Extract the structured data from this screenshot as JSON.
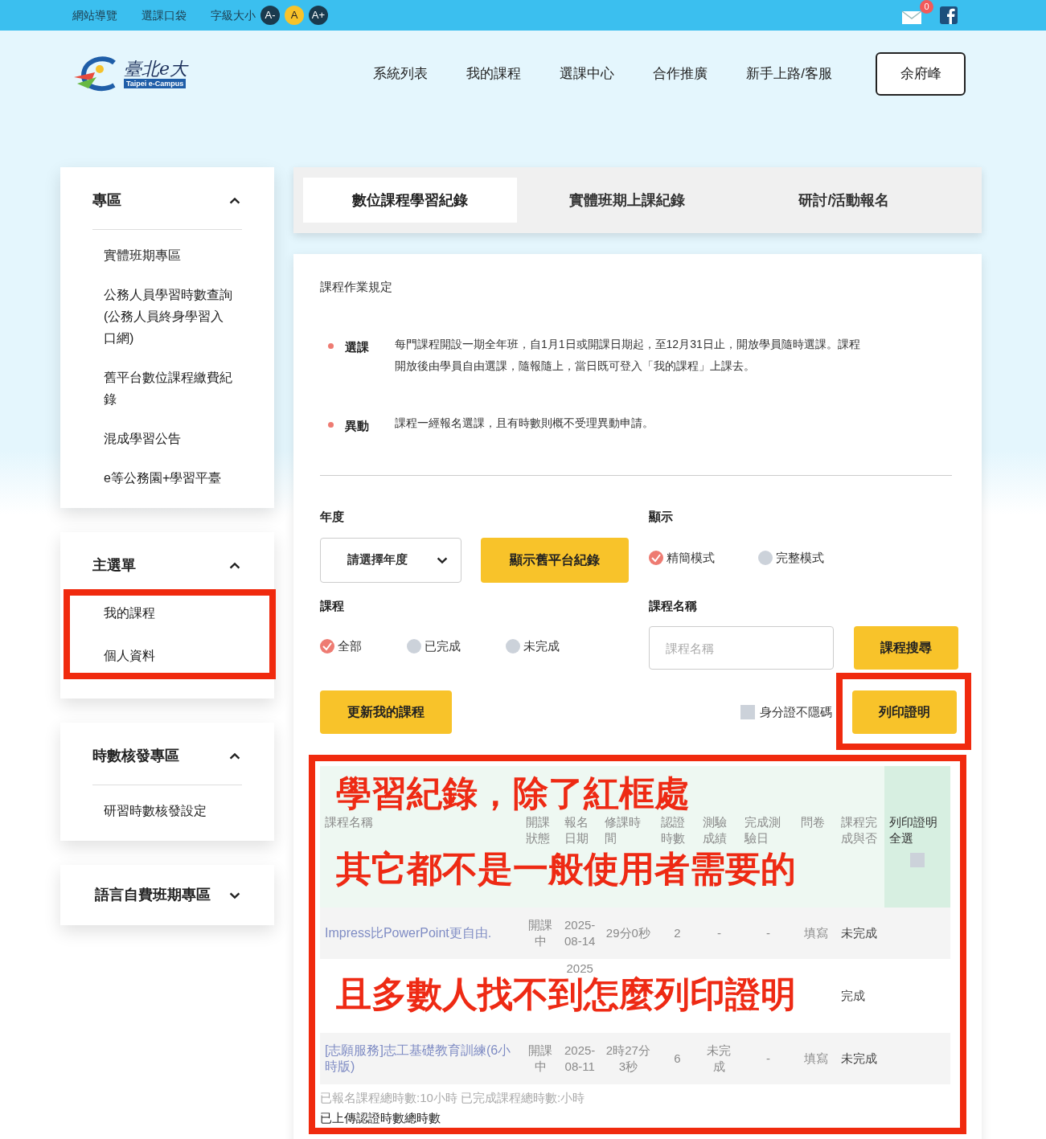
{
  "top_bar": {
    "links": [
      "網站導覽",
      "選課口袋"
    ],
    "font_size": {
      "label": "字級大小",
      "options": [
        {
          "label": "A-",
          "selected": false
        },
        {
          "label": "A",
          "selected": true
        },
        {
          "label": "A+",
          "selected": false
        }
      ]
    },
    "mail_count": "0"
  },
  "header": {
    "logo": {
      "text": "臺北e大",
      "subtitle": "Taipei e-Campus"
    },
    "nav": [
      "系統列表",
      "我的課程",
      "選課中心",
      "合作推廣",
      "新手上路/客服"
    ],
    "user": "余府峰"
  },
  "sidebar": [
    {
      "title": "專區",
      "expanded": true,
      "items": [
        "實體班期專區",
        "公務人員學習時數查詢\n(公務人員終身學習入口網)",
        "舊平台數位課程繳費紀錄",
        "混成學習公告",
        "e等公務園+學習平臺"
      ]
    },
    {
      "title": "主選單",
      "expanded": true,
      "highlighted": true,
      "items": [
        "我的課程",
        "個人資料"
      ]
    },
    {
      "title": "時數核發專區",
      "expanded": true,
      "items": [
        "研習時數核發設定"
      ]
    },
    {
      "title": "語言自費班期專區",
      "expanded": false
    }
  ],
  "tabs": [
    {
      "label": "數位課程學習紀錄",
      "selected": true
    },
    {
      "label": "實體班期上課紀錄",
      "selected": false
    },
    {
      "label": "研討/活動報名",
      "selected": false
    }
  ],
  "rules": {
    "title": "課程作業規定",
    "items": [
      {
        "term": "選課",
        "text": "每門課程開設一期全年班，自1月1日或開課日期起，至12月31日止，開放學員隨時選課。課程開放後由學員自由選課，隨報隨上，當日既可登入「我的課程」上課去。"
      },
      {
        "term": "異動",
        "text": "課程一經報名選課，且有時數則概不受理異動申請。"
      }
    ]
  },
  "filters": {
    "year": {
      "label": "年度",
      "value": "請選擇年度"
    },
    "old_records_button": "顯示舊平台紀錄",
    "display": {
      "label": "顯示",
      "options": [
        {
          "label": "精簡模式",
          "selected": true
        },
        {
          "label": "完整模式",
          "selected": false
        }
      ]
    },
    "course": {
      "label": "課程",
      "options": [
        {
          "label": "全部",
          "selected": true
        },
        {
          "label": "已完成",
          "selected": false
        },
        {
          "label": "未完成",
          "selected": false
        }
      ]
    },
    "course_name": {
      "label": "課程名稱",
      "placeholder": "課程名稱"
    },
    "search_button": "課程搜尋",
    "update_button": "更新我的課程",
    "id_unmask": {
      "label": "身分證不隱碼",
      "checked": false
    },
    "print_button": "列印證明"
  },
  "table": {
    "select_all_checked": false,
    "columns": [
      "課程名稱",
      "開課狀態",
      "報名日期",
      "修課時間",
      "認證時數",
      "測驗成績",
      "完成測驗日",
      "問卷",
      "課程完成與否",
      "列印證明全選"
    ],
    "rows": [
      [
        "Impress比PowerPoint更自由.",
        "開課中",
        "2025-08-14",
        "29分0秒",
        "2",
        "-",
        "-",
        "填寫",
        "未完成"
      ],
      [
        "",
        "",
        "2025",
        "",
        "",
        "",
        "",
        "",
        "完成"
      ],
      [
        "[志願服務]志工基礎教育訓練(6小時版)",
        "開課中",
        "2025-08-11",
        "2時27分3秒",
        "6",
        "未完成",
        "-",
        "填寫",
        "未完成"
      ]
    ]
  },
  "summary": [
    "已報名課程總時數:10小時 已完成課程總時數:小時",
    "已上傳認證時數總時數"
  ],
  "annotations": [
    "學習紀錄，除了紅框處",
    "其它都不是一般使用者需要的",
    "且多數人找不到怎麼列印證明"
  ]
}
